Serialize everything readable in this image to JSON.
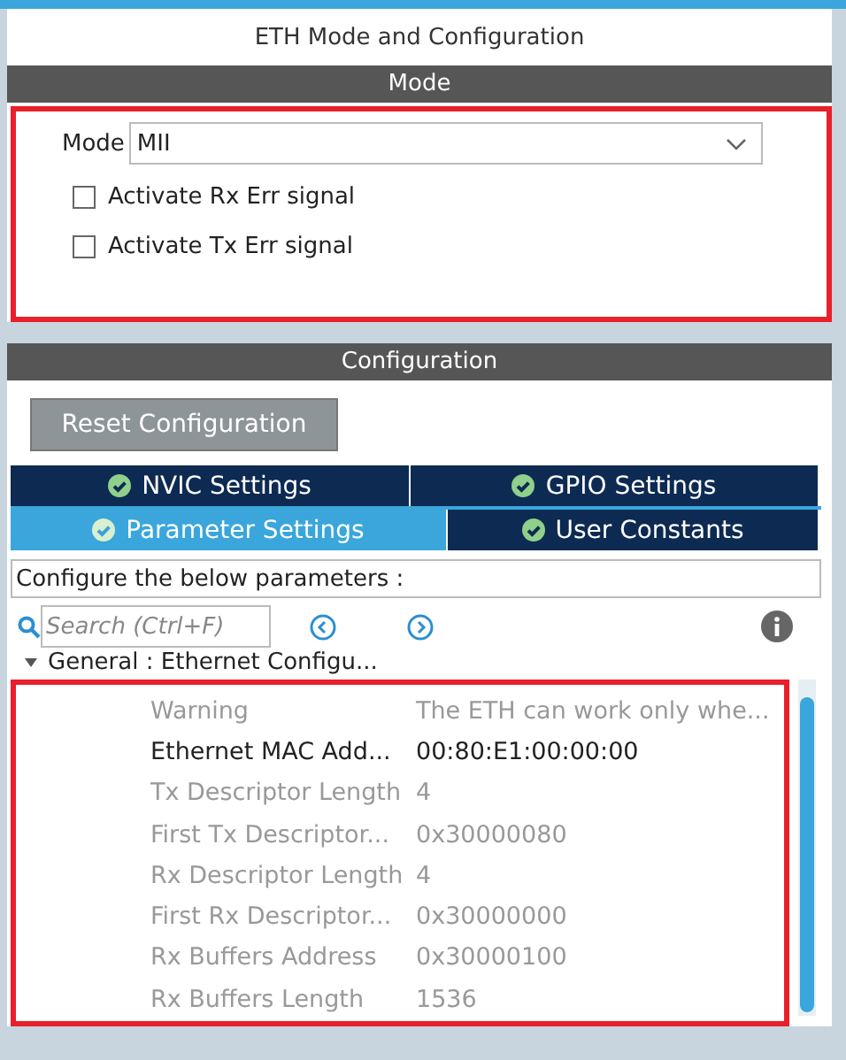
{
  "window": {
    "title": "ETH Mode and Configuration"
  },
  "mode_section": {
    "header": "Mode",
    "mode_label": "Mode",
    "mode_value": "MII",
    "checkboxes": [
      {
        "label": "Activate Rx Err signal",
        "checked": false
      },
      {
        "label": "Activate Tx Err signal",
        "checked": false
      }
    ]
  },
  "configuration": {
    "header": "Configuration",
    "reset_button": "Reset Configuration",
    "tabs": [
      {
        "label": "NVIC Settings",
        "selected": false
      },
      {
        "label": "GPIO Settings",
        "selected": false
      },
      {
        "label": "Parameter Settings",
        "selected": true
      },
      {
        "label": "User Constants",
        "selected": false
      }
    ],
    "hint": "Configure the below parameters :",
    "search": {
      "placeholder": "Search (Ctrl+F)"
    },
    "group": {
      "label": "General : Ethernet Configu...",
      "expanded": true
    },
    "parameters": [
      {
        "name": "Warning",
        "value": "The ETH can work only whe...",
        "disabled": true
      },
      {
        "name": "Ethernet MAC Add...",
        "value": "00:80:E1:00:00:00",
        "disabled": false
      },
      {
        "name": "Tx Descriptor Length",
        "value": "4",
        "disabled": true
      },
      {
        "name": "First Tx Descriptor...",
        "value": "0x30000080",
        "disabled": true
      },
      {
        "name": "Rx Descriptor Length",
        "value": "4",
        "disabled": true
      },
      {
        "name": "First Rx Descriptor...",
        "value": "0x30000000",
        "disabled": true
      },
      {
        "name": "Rx Buffers Address",
        "value": "0x30000100",
        "disabled": true
      },
      {
        "name": "Rx Buffers Length",
        "value": "1536",
        "disabled": true
      }
    ]
  }
}
